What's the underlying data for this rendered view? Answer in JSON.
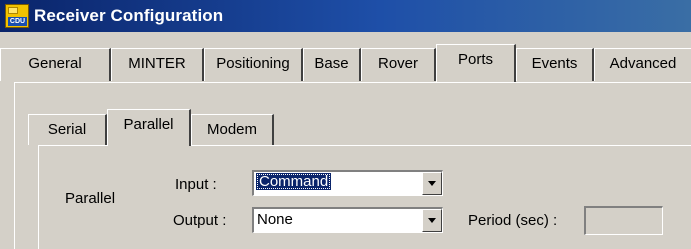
{
  "window": {
    "title": "Receiver Configuration",
    "app_icon_text": "CDU"
  },
  "tabs": [
    {
      "label": "General"
    },
    {
      "label": "MINTER"
    },
    {
      "label": "Positioning"
    },
    {
      "label": "Base"
    },
    {
      "label": "Rover"
    },
    {
      "label": "Ports",
      "active": true
    },
    {
      "label": "Events"
    },
    {
      "label": "Advanced"
    }
  ],
  "subtabs": [
    {
      "label": "Serial"
    },
    {
      "label": "Parallel",
      "active": true
    },
    {
      "label": "Modem"
    }
  ],
  "parallel": {
    "group_label": "Parallel",
    "input_label": "Input :",
    "input_value": "Command",
    "output_label": "Output :",
    "output_value": "None",
    "period_label": "Period (sec) :",
    "period_value": ""
  }
}
